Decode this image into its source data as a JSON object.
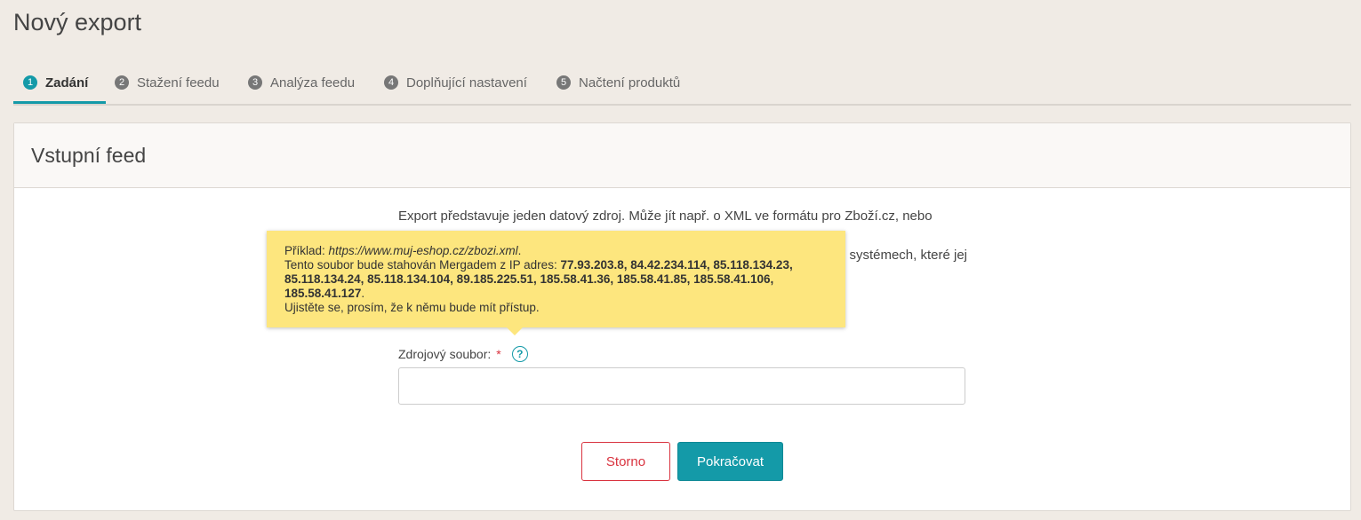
{
  "page": {
    "title": "Nový export"
  },
  "steps": [
    {
      "num": "1",
      "label": "Zadání"
    },
    {
      "num": "2",
      "label": "Stažení feedu"
    },
    {
      "num": "3",
      "label": "Analýza feedu"
    },
    {
      "num": "4",
      "label": "Doplňující nastavení"
    },
    {
      "num": "5",
      "label": "Načtení produktů"
    }
  ],
  "panel": {
    "title": "Vstupní feed",
    "desc1": "Export představuje jeden datový zdroj. Může jít např. o XML ve formátu pro Zboží.cz, nebo",
    "desc2_end": "systémech, které jej"
  },
  "tooltip": {
    "example_prefix": "Příklad: ",
    "example_url": "https://www.muj-eshop.cz/zbozi.xml",
    "example_suffix": ".",
    "ip_prefix": "Tento soubor bude stahován Mergadem z IP adres: ",
    "ips": "77.93.203.8, 84.42.234.114, 85.118.134.23, 85.118.134.24, 85.118.134.104, 89.185.225.51, 185.58.41.36, 185.58.41.85, 185.58.41.106, 185.58.41.127",
    "ip_suffix": ".",
    "access_note": "Ujistěte se, prosím, že k němu bude mít přístup."
  },
  "form": {
    "source_label": "Zdrojový soubor:",
    "required_mark": "*",
    "help_glyph": "?",
    "source_value": ""
  },
  "buttons": {
    "cancel": "Storno",
    "continue": "Pokračovat"
  },
  "colors": {
    "accent": "#149aa8",
    "danger": "#d9333f",
    "tooltip_bg": "#fde67e",
    "page_bg": "#f0ebe5"
  }
}
